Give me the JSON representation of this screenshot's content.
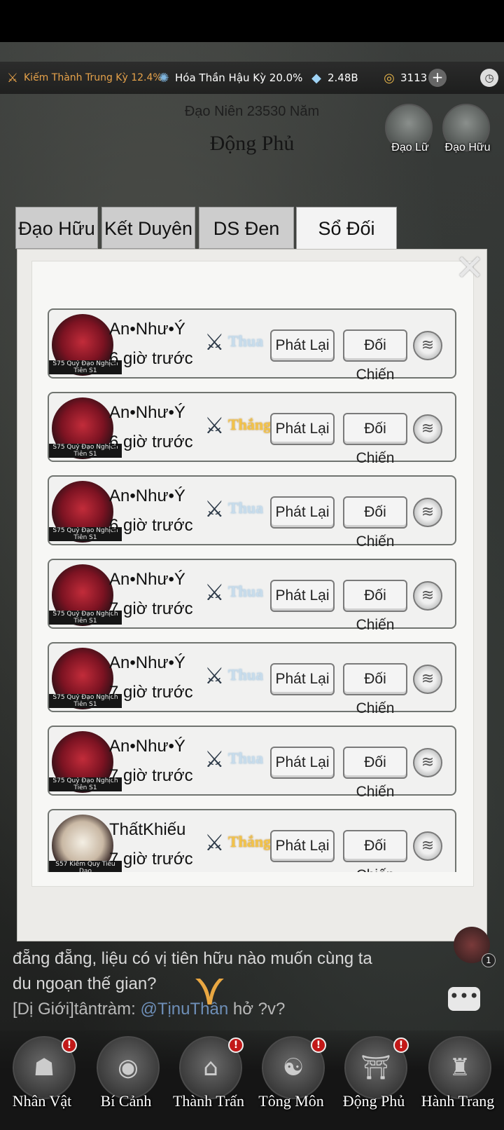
{
  "resources": {
    "realm_1": "Kiếm Thành Trung Kỳ 12.4%",
    "realm_2": "Hóa Thần Hậu Kỳ 20.0%",
    "spirit_stones": "2.48B",
    "gold": "3113"
  },
  "header": {
    "dao_year": "Đạo Niên 23530 Năm",
    "title": "Động Phủ",
    "dao_lu": "Đạo Lữ",
    "dao_huu": "Đạo Hữu"
  },
  "tabs": [
    {
      "label": "Đạo Hữu"
    },
    {
      "label": "Kết Duyên"
    },
    {
      "label": "DS Đen"
    },
    {
      "label": "Sổ Đối Chiến"
    }
  ],
  "records": [
    {
      "name": "An•Như•Ý",
      "time": "6 giờ trước",
      "result": "Thua",
      "tag": "S75 Quỷ Đạo Nghịch Tiên S1"
    },
    {
      "name": "An•Như•Ý",
      "time": "6 giờ trước",
      "result": "Thắng",
      "tag": "S75 Quỷ Đạo Nghịch Tiên S1"
    },
    {
      "name": "An•Như•Ý",
      "time": "6 giờ trước",
      "result": "Thua",
      "tag": "S75 Quỷ Đạo Nghịch Tiên S1"
    },
    {
      "name": "An•Như•Ý",
      "time": "7 giờ trước",
      "result": "Thua",
      "tag": "S75 Quỷ Đạo Nghịch Tiên S1"
    },
    {
      "name": "An•Như•Ý",
      "time": "7 giờ trước",
      "result": "Thua",
      "tag": "S75 Quỷ Đạo Nghịch Tiên S1"
    },
    {
      "name": "An•Như•Ý",
      "time": "7 giờ trước",
      "result": "Thua",
      "tag": "S75 Quỷ Đạo Nghịch Tiên S1"
    },
    {
      "name": "ThấtKhiếu",
      "time": "7 giờ trước",
      "result": "Thắng",
      "tag": "S57 Kiếm Quy Tiêu Dao"
    }
  ],
  "buttons": {
    "replay": "Phát Lại",
    "fight": "Đối Chiến"
  },
  "chat": {
    "line1": "đẵng đẵng, liệu có vị tiên hữu nào muốn cùng ta",
    "line2": "du ngoạn thế gian?",
    "line3_prefix": "[Dị Giới]tântràm:",
    "line3_mention": "@TịnuThần",
    "line3_suffix": " hở ?v?",
    "badge_count": "1"
  },
  "nav": [
    {
      "label": "Nhân Vật",
      "badge": "!"
    },
    {
      "label": "Bí Cảnh",
      "badge": ""
    },
    {
      "label": "Thành Trấn",
      "badge": "!"
    },
    {
      "label": "Tông Môn",
      "badge": "!"
    },
    {
      "label": "Động Phủ",
      "badge": "!"
    },
    {
      "label": "Hành Trang",
      "badge": ""
    }
  ]
}
